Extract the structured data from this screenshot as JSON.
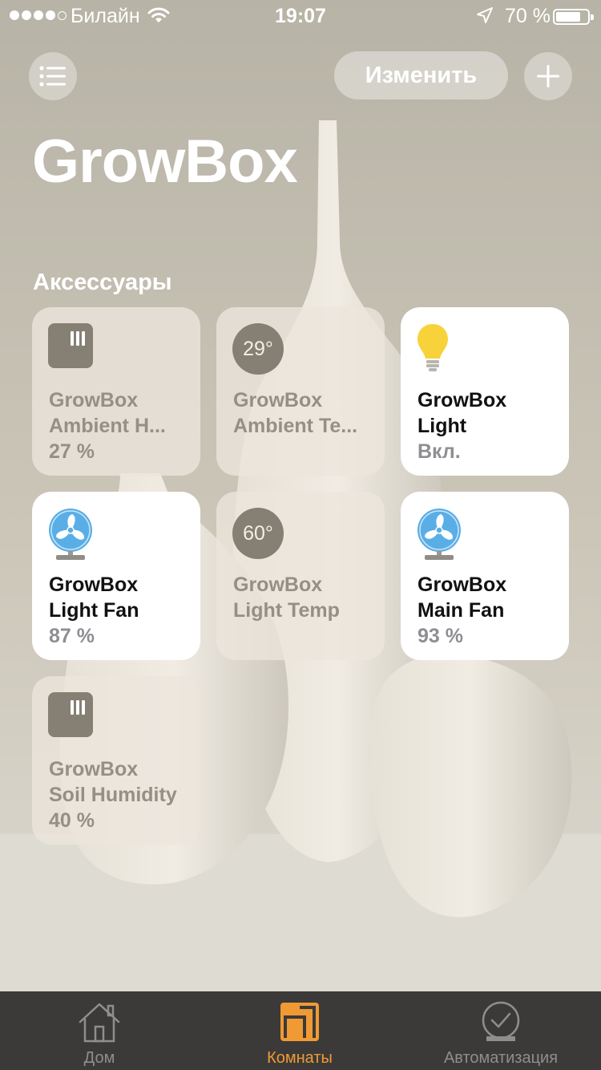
{
  "status_bar": {
    "carrier": "Билайн",
    "time": "19:07",
    "battery_percent": "70 %",
    "signal_bars_filled": 4,
    "signal_bars_total": 5
  },
  "header": {
    "edit_label": "Изменить",
    "title": "GrowBox",
    "menu_icon": "list-icon",
    "add_icon": "plus-icon"
  },
  "section_title": "Аксессуары",
  "accessories": [
    {
      "line1": "GrowBox",
      "line2": "Ambient H...",
      "state": "27 %",
      "active": false,
      "icon": "humidity-sensor-icon"
    },
    {
      "line1": "GrowBox",
      "line2": "Ambient Te...",
      "state": "",
      "active": false,
      "icon": "temperature-icon",
      "icon_text": "29°"
    },
    {
      "line1": "GrowBox",
      "line2": "Light",
      "state": "Вкл.",
      "active": true,
      "icon": "lightbulb-icon"
    },
    {
      "line1": "GrowBox",
      "line2": "Light Fan",
      "state": "87 %",
      "active": true,
      "icon": "fan-icon"
    },
    {
      "line1": "GrowBox",
      "line2": "Light Temp",
      "state": "",
      "active": false,
      "icon": "temperature-icon",
      "icon_text": "60°"
    },
    {
      "line1": "GrowBox",
      "line2": "Main Fan",
      "state": "93 %",
      "active": true,
      "icon": "fan-icon"
    },
    {
      "line1": "GrowBox",
      "line2": "Soil Humidity",
      "state": "40 %",
      "active": false,
      "icon": "humidity-sensor-icon"
    }
  ],
  "tab_bar": {
    "tabs": [
      {
        "label": "Дом",
        "icon": "house-icon",
        "selected": false
      },
      {
        "label": "Комнаты",
        "icon": "rooms-icon",
        "selected": true
      },
      {
        "label": "Автоматизация",
        "icon": "clock-check-icon",
        "selected": false
      }
    ]
  },
  "colors": {
    "accent": "#f09a34",
    "tab_bar_bg": "#3b3a38",
    "sensor_icon": "#857f74",
    "fan_blue": "#5aaee6",
    "bulb_yellow": "#f8d23a"
  }
}
